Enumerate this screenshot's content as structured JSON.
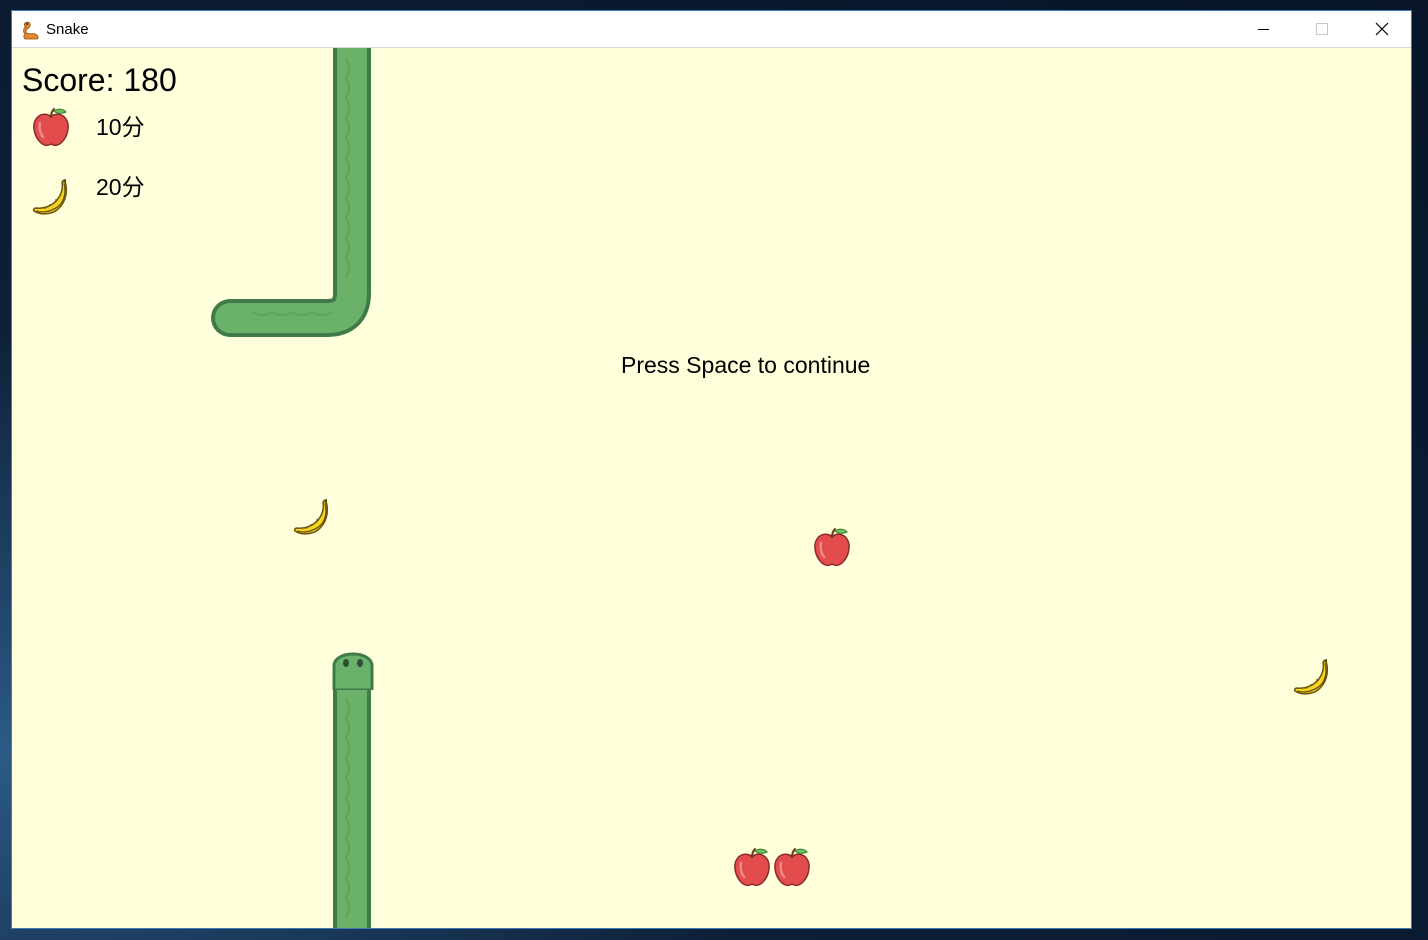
{
  "window": {
    "title": "Snake",
    "app_icon": "snake-app-icon",
    "controls": [
      "minimize-icon",
      "maximize-icon",
      "close-icon"
    ]
  },
  "hud": {
    "score_text": "Score: 180",
    "legend": [
      {
        "item": "apple",
        "points_label": "10分"
      },
      {
        "item": "banana",
        "points_label": "20分"
      }
    ]
  },
  "game": {
    "state_message": "Press Space to continue",
    "background_color": "#ffffdc",
    "snake_color": "#6ab26a",
    "snake_outline_color": "#3f7a48",
    "fruits": [
      "banana",
      "apple",
      "banana",
      "apple",
      "apple"
    ]
  }
}
